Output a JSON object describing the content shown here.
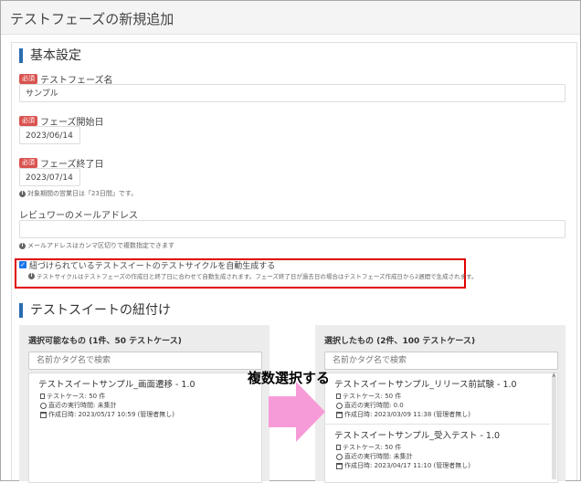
{
  "page": {
    "title": "テストフェーズの新規追加"
  },
  "basic": {
    "section_title": "基本設定",
    "required_badge": "必須",
    "phase_name": {
      "label": "テストフェーズ名",
      "value": "サンプル"
    },
    "start_date": {
      "label": "フェーズ開始日",
      "value": "2023/06/14"
    },
    "end_date": {
      "label": "フェーズ終了日",
      "value": "2023/07/14"
    },
    "business_days_note": "対象期間の営業日は「23日間」です。",
    "reviewer": {
      "label": "レビュワーのメールアドレス",
      "value": "",
      "note": "メールアドレスはカンマ区切りで複数指定できます"
    },
    "auto_cycle": {
      "checked": true,
      "label": "紐づけられているテストスイートのテストサイクルを自動生成する",
      "note": "テストサイクルはテストフェーズの作成日と終了日に合わせて自動生成されます。フェーズ終了日が過去日の場合はテストフェーズ作成日から2週間で生成されます。"
    }
  },
  "suites": {
    "section_title": "テストスイートの紐付け",
    "available": {
      "title": "選択可能なもの (1件、50 テストケース)",
      "search_placeholder": "名前かタグ名で検索",
      "items": [
        {
          "title": "テストスイートサンプル_画面遷移 - 1.0",
          "cases": "テストケース: 50 件",
          "last_run": "直近の実行時間: 未集計",
          "created": "作成日時: 2023/05/17 10:59 (管理者無し)"
        }
      ]
    },
    "selected": {
      "title": "選択したもの (2件、100 テストケース)",
      "search_placeholder": "名前かタグ名で検索",
      "items": [
        {
          "title": "テストスイートサンプル_リリース前試験 - 1.0",
          "cases": "テストケース: 50 件",
          "last_run": "直近の実行時間: 0.0",
          "created": "作成日時: 2023/03/09 11:38 (管理者無し)"
        },
        {
          "title": "テストスイートサンプル_受入テスト - 1.0",
          "cases": "テストケース: 50 件",
          "last_run": "直近の実行時間: 未集計",
          "created": "作成日時: 2023/04/17 11:10 (管理者無し)"
        }
      ]
    }
  },
  "annotation": {
    "text": "複数選択する"
  },
  "colors": {
    "accent": "#2b6cb0",
    "required": "#d9534f",
    "highlight_border": "#e00000",
    "arrow": "#f79bd8"
  }
}
